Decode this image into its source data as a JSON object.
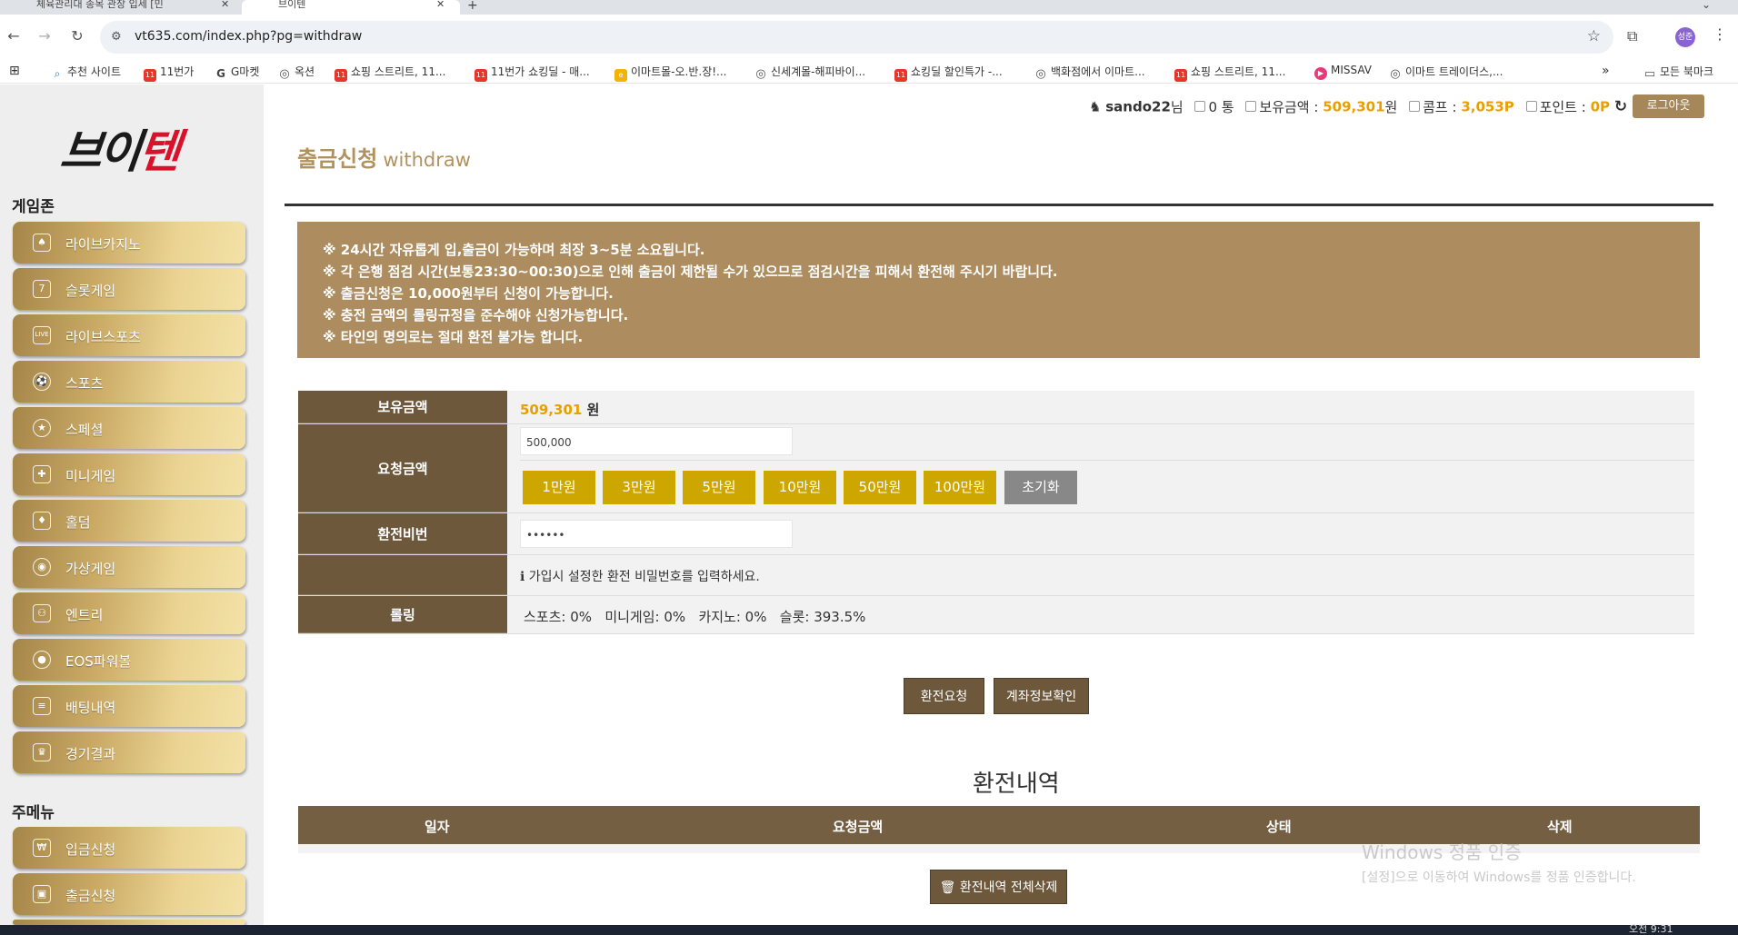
{
  "browser": {
    "tabs": [
      {
        "label": "체육관리대 종목 관장 입세 [민"
      },
      {
        "label": "브이텐"
      }
    ],
    "url": "vt635.com/index.php?pg=withdraw",
    "profile_initials": "성준",
    "bookmarks": [
      {
        "label": "추천 사이트",
        "icon": "search-icon"
      },
      {
        "label": "11번가",
        "icon": "11st-icon"
      },
      {
        "label": "G마켓",
        "icon": "gmarket-icon"
      },
      {
        "label": "옥션",
        "icon": "globe-icon"
      },
      {
        "label": "쇼핑 스트리트, 11...",
        "icon": "11st-icon"
      },
      {
        "label": "11번가 쇼킹딜 - 매...",
        "icon": "11st-icon"
      },
      {
        "label": "이마트몰-오.반.장!...",
        "icon": "emart-icon"
      },
      {
        "label": "신세계몰-해피바이...",
        "icon": "globe-icon"
      },
      {
        "label": "쇼킹딜 할인특가 -...",
        "icon": "11st-icon"
      },
      {
        "label": "백화점에서 이마트...",
        "icon": "globe-icon"
      },
      {
        "label": "쇼핑 스트리트, 11...",
        "icon": "11st-icon"
      },
      {
        "label": "MISSAV",
        "icon": "missav-icon"
      },
      {
        "label": "이마트 트레이더스,...",
        "icon": "globe-icon"
      }
    ],
    "all_bookmarks": "모든 북마크"
  },
  "logo": {
    "part1": "브이",
    "part2": "텐"
  },
  "sidebar": {
    "game_zone_title": "게임존",
    "game_items": [
      {
        "label": "라이브카지노",
        "icon": "card-icon"
      },
      {
        "label": "슬롯게임",
        "icon": "slot-icon"
      },
      {
        "label": "라이브스포츠",
        "icon": "live-icon"
      },
      {
        "label": "스포츠",
        "icon": "soccer-ball-icon"
      },
      {
        "label": "스페셜",
        "icon": "special-icon"
      },
      {
        "label": "미니게임",
        "icon": "gamepad-icon"
      },
      {
        "label": "홀덤",
        "icon": "poker-cards-icon"
      },
      {
        "label": "가상게임",
        "icon": "vr-icon"
      },
      {
        "label": "엔트리",
        "icon": "entry-icon"
      },
      {
        "label": "EOS파워볼",
        "icon": "powerball-icon"
      },
      {
        "label": "배팅내역",
        "icon": "history-icon"
      },
      {
        "label": "경기결과",
        "icon": "trophy-icon"
      }
    ],
    "main_menu_title": "주메뉴",
    "main_items": [
      {
        "label": "입금신청",
        "icon": "deposit-icon"
      },
      {
        "label": "출금신청",
        "icon": "wallet-icon"
      }
    ]
  },
  "user": {
    "username": "sando22",
    "honorific": "님",
    "messages": "0 통",
    "balance_label": "보유금액 :",
    "balance": "509,301",
    "balance_unit": "원",
    "comp_label": "콤프 :",
    "comp": "3,053",
    "comp_unit": "P",
    "point_label": "포인트 :",
    "point": "0P",
    "logout": "로그아웃"
  },
  "page": {
    "title": "출금신청",
    "subtitle": "withdraw",
    "notices": [
      "※ 24시간 자유롭게 입,출금이 가능하며 최장 3~5분 소요됩니다.",
      "※ 각 은행 점검 시간(보통23:30~00:30)으로 인해 출금이 제한될 수가 있으므로 점검시간을 피해서 환전해 주시기 바랍니다.",
      "※ 출금신청은 10,000원부터 신청이 가능합니다.",
      "※ 충전 금액의 롤링규정을 준수해야 신청가능합니다.",
      "※ 타인의 명의로는 절대 환전 불가능 합니다."
    ]
  },
  "form": {
    "balance_label": "보유금액",
    "balance_value": "509,301",
    "balance_unit": "원",
    "request_label": "요청금액",
    "request_value": "500,000",
    "amount_buttons": [
      "1만원",
      "3만원",
      "5만원",
      "10만원",
      "50만원",
      "100만원"
    ],
    "reset_button": "초기화",
    "password_label": "환전비번",
    "password_value": "••••••",
    "password_hint": "가입시 설정한 환전 비밀번호를 입력하세요.",
    "rolling_label": "롤링",
    "rolling_value": "스포츠: 0%   미니게임: 0%   카지노: 0%   슬롯: 393.5%",
    "submit_button": "환전요청",
    "account_button": "계좌정보확인"
  },
  "history": {
    "title": "환전내역",
    "columns": [
      "일자",
      "요청금액",
      "상태",
      "삭제"
    ],
    "delete_all": "환전내역 전체삭제"
  },
  "watermark": {
    "line1": "Windows 정품 인증",
    "line2": "[설정]으로 이동하여 Windows를 정품 인증합니다."
  },
  "taskbar": {
    "clock": "오전 9:31"
  },
  "colors": {
    "gold_accent": "#b1925e",
    "brown_label": "#6d583c",
    "amount_button": "#cda600",
    "highlight_number": "#e8a000"
  }
}
